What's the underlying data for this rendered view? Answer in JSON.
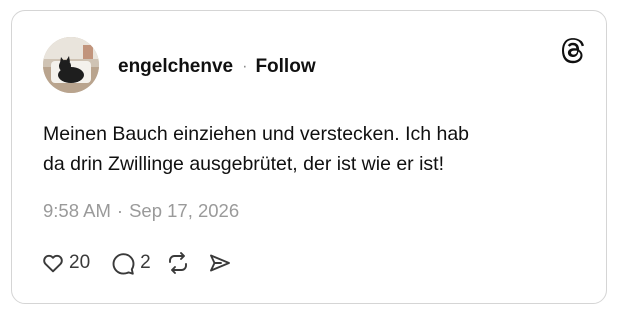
{
  "post": {
    "author": {
      "username": "engelchenve",
      "separator": "·",
      "follow_label": "Follow",
      "avatar_icon": "cat-photo-avatar"
    },
    "brand_icon": "threads-logo-icon",
    "text_line1": "Meinen Bauch einziehen und verstecken. Ich hab",
    "text_line2": "da drin Zwillinge ausgebrütet, der ist wie er ist!",
    "time": "9:58 AM",
    "time_separator": "·",
    "date": "Sep 17, 2026",
    "actions": {
      "like": {
        "icon": "heart-icon",
        "count": "20"
      },
      "reply": {
        "icon": "speech-bubble-icon",
        "count": "2"
      },
      "repost": {
        "icon": "repost-icon"
      },
      "share": {
        "icon": "send-icon"
      }
    }
  },
  "colors": {
    "text": "#101010",
    "muted": "#9a9a9a",
    "border": "#d5d5d5",
    "background": "#ffffff"
  }
}
